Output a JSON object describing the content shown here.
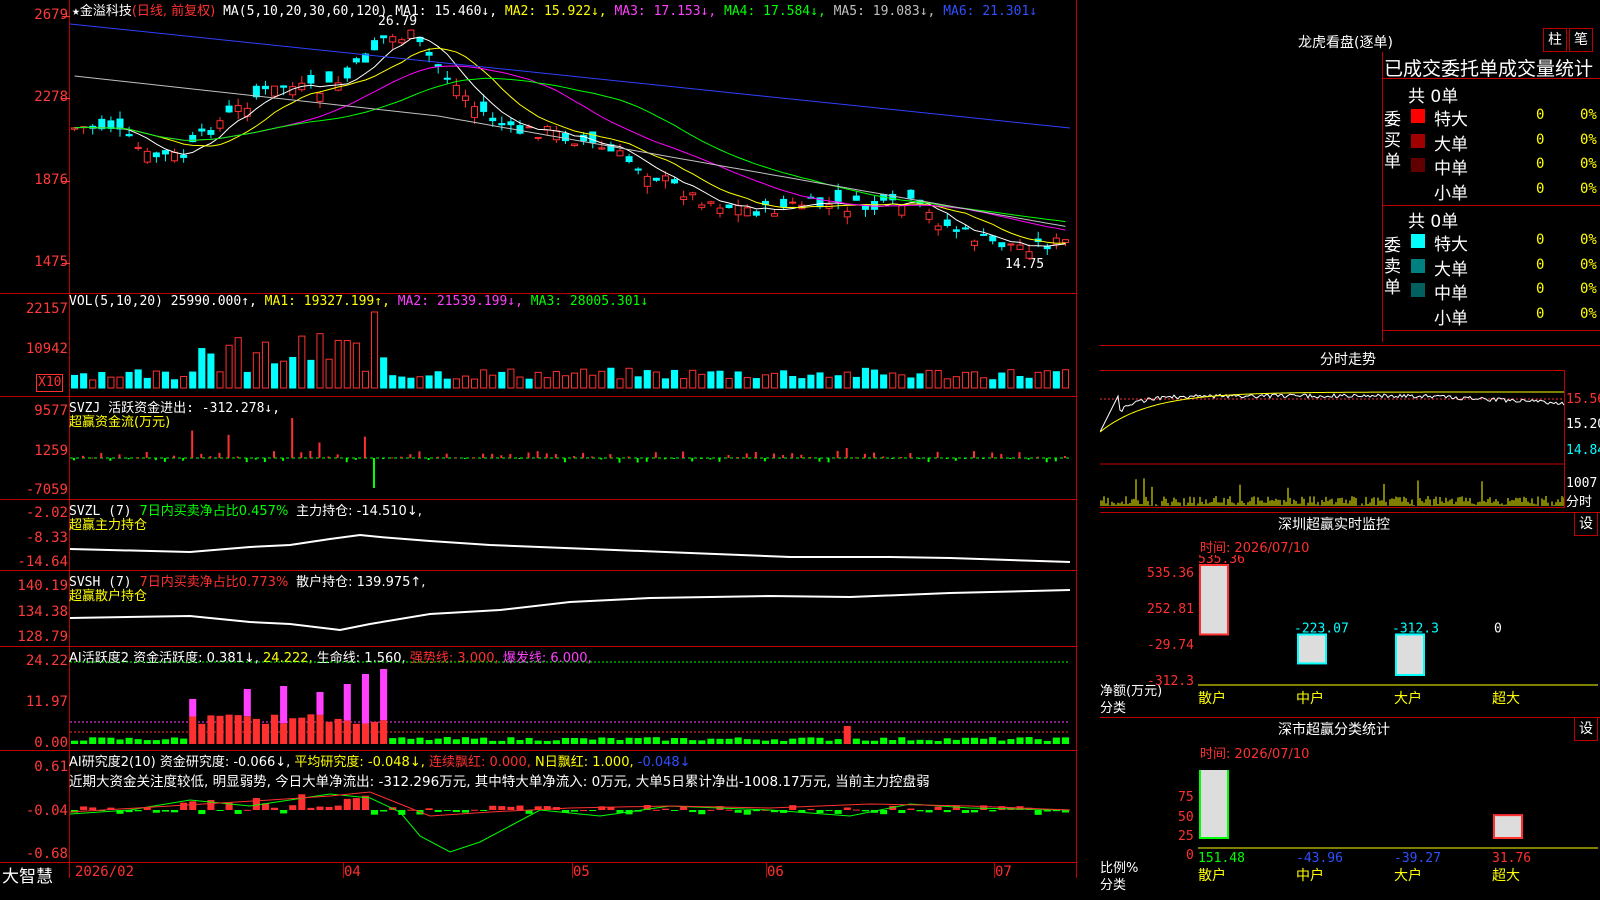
{
  "main_chart": {
    "star": "★",
    "stock_name": "金溢科技",
    "period_tag": "(日线, 前复权)",
    "ma_params": "MA(5,10,20,30,60,120)",
    "ma1": "MA1: 15.460↓,",
    "ma2": "MA2: 15.922↓,",
    "ma3": "MA3: 17.153↓,",
    "ma4": "MA4: 17.584↓,",
    "ma5": "MA5: 19.083↓,",
    "ma6": "MA6: 21.301↓",
    "high_mark": "26.79",
    "low_mark": "14.75",
    "y_ticks": [
      "2679",
      "2278",
      "1876",
      "1475"
    ],
    "colors": {
      "ma1": "#ffffff",
      "ma2": "#ffff00",
      "ma3": "#ff00ff",
      "ma4": "#00ff00",
      "ma5": "#c0c0c0",
      "ma6": "#3040ff"
    }
  },
  "vol_panel": {
    "label": "VOL(5,10,20)",
    "value": "25990.000↑,",
    "ma1": "MA1: 19327.199↑,",
    "ma2": "MA2: 21539.199↓,",
    "ma3": "MA3: 28005.301↓",
    "y_ticks": [
      "22157",
      "10942"
    ],
    "unit_tag": "X10"
  },
  "svzj_panel": {
    "label": "SVZJ  活跃资金进出: -312.278↓,",
    "sub": "超赢资金流(万元)",
    "y_ticks": [
      "9577",
      "1259",
      "-7059"
    ]
  },
  "svzl_panel": {
    "label_pre": "SVZL (7)",
    "label_mid": "7日内买卖净占比0.457%",
    "label_post": "主力持仓: -14.510↓,",
    "sub": "超赢主力持仓",
    "y_ticks": [
      "-2.02",
      "-8.33",
      "-14.64"
    ]
  },
  "svsh_panel": {
    "label_pre": "SVSH (7)",
    "label_mid": "7日内买卖净占比0.773%",
    "label_post": "散户持仓: 139.975↑,",
    "sub": "超赢散户持仓",
    "y_ticks": [
      "140.19",
      "134.38",
      "128.79"
    ]
  },
  "ai_active_panel": {
    "label": "AI活跃度2 资金活跃度: 0.381↓,",
    "v1": "24.222,",
    "v2": "生命线: 1.560,",
    "v3": "强势线: 3.000,",
    "v4": "爆发线: 6.000,",
    "y_ticks": [
      "24.22",
      "11.97",
      "0.00"
    ]
  },
  "ai_research_panel": {
    "label": "AI研究度2(10) 资金研究度: -0.066↓,",
    "avg": "平均研究度: -0.048↓,",
    "streak": "连续飘红: 0.000,",
    "nday": "N日飘红: 1.000,",
    "last": "-0.048↓",
    "comment": "近期大资金关注度较低, 明显弱势, 今日大单净流出: -312.296万元, 其中特大单净流入: 0万元, 大单5日累计净出-1008.17万元, 当前主力控盘弱",
    "y_ticks": [
      "0.61",
      "-0.04",
      "-0.68"
    ]
  },
  "x_axis": {
    "app_name": "大智慧",
    "labels": [
      "2026/02",
      "04",
      "05",
      "06",
      "07"
    ]
  },
  "longhu": {
    "title": "龙虎看盘(逐单)",
    "btn1": "柱",
    "btn2": "笔",
    "header": "已成交委托单成交量统计",
    "buy_total": "共 0单",
    "buy_side": "委买单",
    "sell_total": "共 0单",
    "sell_side": "委卖单",
    "buy_rows": [
      {
        "label": "特大",
        "count": "0",
        "pct": "0%",
        "color": "#ff0000"
      },
      {
        "label": "大单",
        "count": "0",
        "pct": "0%",
        "color": "#a00000"
      },
      {
        "label": "中单",
        "count": "0",
        "pct": "0%",
        "color": "#600000"
      },
      {
        "label": "小单",
        "count": "0",
        "pct": "0%",
        "color": ""
      }
    ],
    "sell_rows": [
      {
        "label": "特大",
        "count": "0",
        "pct": "0%",
        "color": "#00ffff"
      },
      {
        "label": "大单",
        "count": "0",
        "pct": "0%",
        "color": "#008080"
      },
      {
        "label": "中单",
        "count": "0",
        "pct": "0%",
        "color": "#006060"
      },
      {
        "label": "小单",
        "count": "0",
        "pct": "0%",
        "color": ""
      }
    ]
  },
  "intraday": {
    "title": "分时走势",
    "y_labels": [
      "15.56",
      "15.20",
      "14.84"
    ],
    "vol_label": "1007",
    "unit": "分时"
  },
  "sz_monitor": {
    "title": "深圳超赢实时监控",
    "btn": "设",
    "time": "时间: 2026/07/10",
    "y_ticks": [
      "535.36",
      "252.81",
      "-29.74",
      "-312.3"
    ],
    "ylabel": "净额(万元)",
    "xlabel": "分类",
    "chart_data": {
      "type": "bar",
      "categories": [
        "散户",
        "中户",
        "大户",
        "超大"
      ],
      "values": [
        535.36,
        -223.07,
        -312.3,
        0
      ],
      "value_labels": [
        "535.36",
        "-223.07",
        "-312.3",
        "0"
      ],
      "ylim": [
        -312.3,
        535.36
      ],
      "xlabel": "分类",
      "ylabel": "净额(万元)"
    }
  },
  "sz_class": {
    "title": "深市超赢分类统计",
    "btn": "设",
    "time": "时间: 2026/07/10",
    "y_ticks": [
      "75",
      "50",
      "25",
      "0"
    ],
    "ylabel": "比例%",
    "xlabel": "分类",
    "chart_data": {
      "type": "bar",
      "categories": [
        "散户",
        "中户",
        "大户",
        "超大"
      ],
      "values": [
        151.48,
        -43.96,
        -39.27,
        31.76
      ],
      "value_labels": [
        "151.48",
        "-43.96",
        "-39.27",
        "31.76"
      ],
      "ylim": [
        0,
        90
      ],
      "xlabel": "分类",
      "ylabel": "比例%"
    }
  }
}
